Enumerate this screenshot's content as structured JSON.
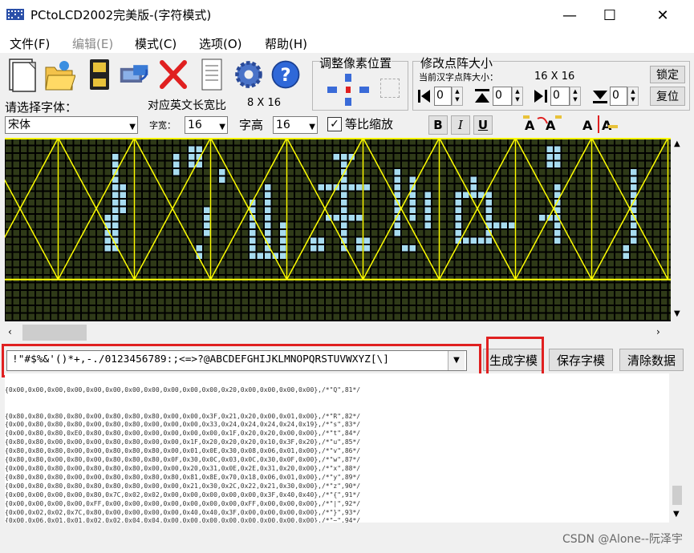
{
  "window": {
    "title": "PCtoLCD2002完美版-(字符模式)",
    "minimize_glyph": "—",
    "maximize_glyph": "☐",
    "close_glyph": "✕"
  },
  "menu": {
    "items": [
      {
        "label": "文件(F)",
        "enabled": true
      },
      {
        "label": "编辑(E)",
        "enabled": false
      },
      {
        "label": "模式(C)",
        "enabled": true
      },
      {
        "label": "选项(O)",
        "enabled": true
      },
      {
        "label": "帮助(H)",
        "enabled": true
      }
    ]
  },
  "toolbar": {
    "icons": [
      "new-document-icon",
      "open-folder-icon",
      "save-disk-icon",
      "export-icon",
      "delete-icon",
      "notepad-icon",
      "settings-gear-icon",
      "help-question-icon"
    ]
  },
  "pixel_adjust": {
    "title": "调整像素位置"
  },
  "matrix_size": {
    "title": "修改点阵大小",
    "current_label": "当前汉字点阵大小：",
    "current_value": "16 X 16",
    "lock_button": "锁定",
    "reset_button": "复位",
    "spin_values": [
      "0",
      "0",
      "0",
      "0"
    ]
  },
  "font": {
    "select_label": "请选择字体：",
    "font_value": "宋体",
    "en_ratio_label": "对应英文长宽比",
    "en_ratio_value": "8 X 16",
    "width_label": "字宽：",
    "width_value": "16",
    "height_label": "字高",
    "height_value": "16",
    "proportional_label": "等比缩放",
    "proportional_checked": true,
    "bold": "B",
    "italic": "I",
    "underline": "U"
  },
  "colors": {
    "grid_bg": "#000000",
    "cell_off": "#2f3a18",
    "cell_on": "#a8dcf0",
    "char_border": "#ffff00",
    "highlight": "#e02020"
  },
  "input": {
    "chars": "!\"#$%&'()*+,-./0123456789:;<=>?@ABCDEFGHIJKLMNOPQRSTUVWXYZ[\\]"
  },
  "buttons": {
    "generate": "生成字模",
    "save": "保存字模",
    "clear": "清除数据"
  },
  "output_lines": [
    "{0x80,0x80,0x80,0x80,0x00,0x80,0x80,0x80,0x00,0x00,0x3F,0x21,0x20,0x00,0x01,0x00},/*\"R\",82*/",
    "{0x00,0x80,0x80,0x80,0x00,0x80,0x80,0x00,0x00,0x00,0x33,0x24,0x24,0x24,0x24,0x19},/*\"s\",83*/",
    "{0x00,0x80,0x80,0xE0,0x80,0x80,0x00,0x00,0x00,0x00,0x00,0x1F,0x20,0x20,0x00,0x00},/*\"t\",84*/",
    "{0x80,0x80,0x00,0x00,0x00,0x80,0x80,0x00,0x00,0x1F,0x20,0x20,0x20,0x10,0x3F,0x20},/*\"u\",85*/",
    "{0x80,0x80,0x80,0x00,0x00,0x80,0x80,0x80,0x00,0x01,0x0E,0x30,0x08,0x06,0x01,0x00},/*\"v\",86*/",
    "{0x80,0x80,0x00,0x80,0x00,0x80,0x80,0x80,0x0F,0x30,0x0C,0x03,0x0C,0x30,0x0F,0x00},/*\"w\",87*/",
    "{0x00,0x80,0x80,0x00,0x80,0x80,0x80,0x00,0x00,0x20,0x31,0x0E,0x2E,0x31,0x20,0x00},/*\"x\",88*/",
    "{0x80,0x80,0x80,0x00,0x00,0x80,0x80,0x80,0x80,0x81,0x8E,0x70,0x18,0x06,0x01,0x00},/*\"y\",89*/",
    "{0x00,0x80,0x80,0x80,0x80,0x80,0x80,0x00,0x00,0x21,0x30,0x2C,0x22,0x21,0x30,0x00},/*\"z\",90*/",
    "{0x00,0x00,0x00,0x00,0x80,0x7C,0x02,0x02,0x00,0x00,0x00,0x00,0x00,0x3F,0x40,0x40},/*\"{\",91*/",
    "{0x00,0x00,0x00,0x00,0xFF,0x00,0x00,0x00,0x00,0x00,0x00,0x00,0xFF,0x00,0x00,0x00},/*\"|\",92*/",
    "{0x00,0x02,0x02,0x7C,0x80,0x00,0x00,0x00,0x00,0x40,0x40,0x3F,0x00,0x00,0x00,0x00},/*\"}\",93*/",
    "{0x00,0x06,0x01,0x01,0x02,0x02,0x04,0x04,0x00,0x00,0x00,0x00,0x00,0x00,0x00,0x00},/*\"~\",94*/"
  ],
  "output_partial_top": "{0x00,0x00,0x00,0x00,0x00,0x00,0x00,0x00,0x00,0x00,0x00,0x20,0x00,0x00,0x00,0x00},/*\"Q\",81*/",
  "watermark": "CSDN @Alone--阮泽宇"
}
